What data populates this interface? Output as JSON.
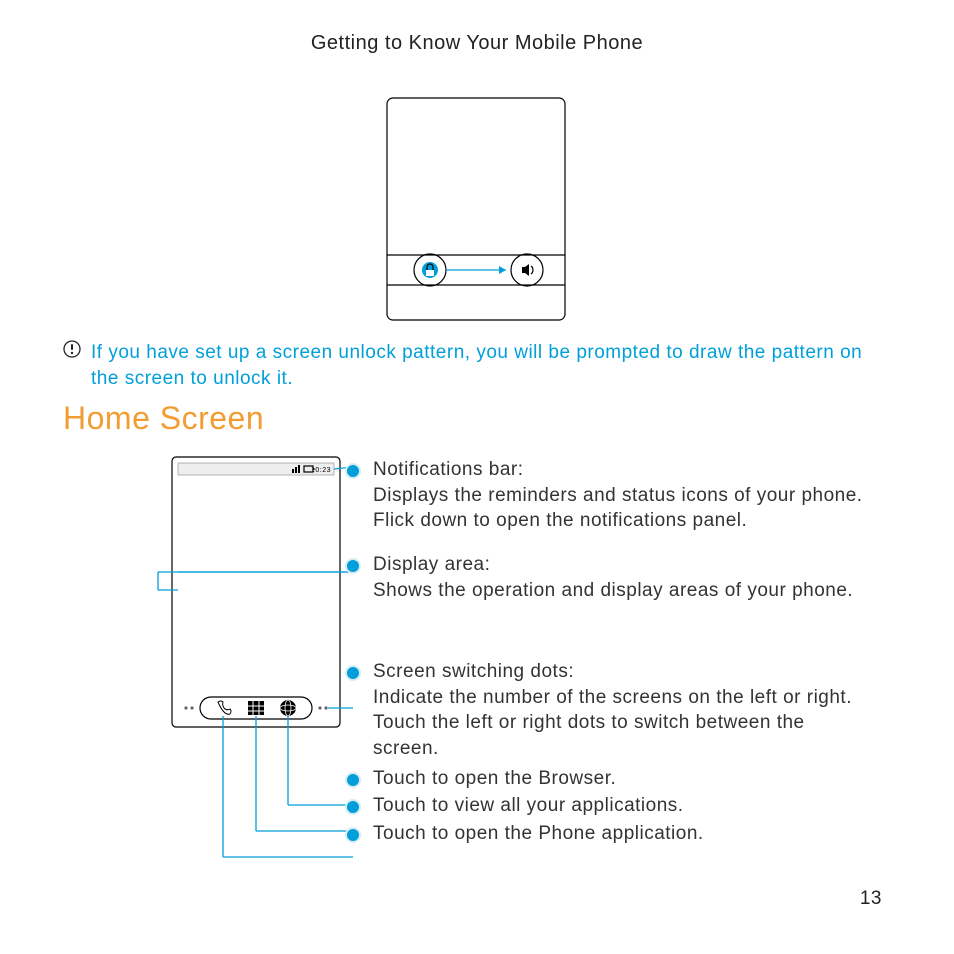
{
  "header": "Getting to Know Your Mobile Phone",
  "note": "If you have set up a screen unlock pattern, you will be prompted to draw the pattern on the screen to unlock it.",
  "section_title": "Home Screen",
  "callouts": {
    "c1_title": "Notifications bar:",
    "c1_body": "Displays the reminders and status icons of your phone. Flick down to open the notifications panel.",
    "c2_title": "Display area:",
    "c2_body": "Shows the operation and display areas of your phone.",
    "c3_title": "Screen switching dots:",
    "c3_body": "Indicate the number of the screens on the left or right. Touch the left or right dots to switch between the screen.",
    "c4": "Touch to open the Browser.",
    "c5": "Touch to view all your applications.",
    "c6": "Touch to open the Phone application."
  },
  "status_bar_time": "10:23",
  "page_number": "13"
}
